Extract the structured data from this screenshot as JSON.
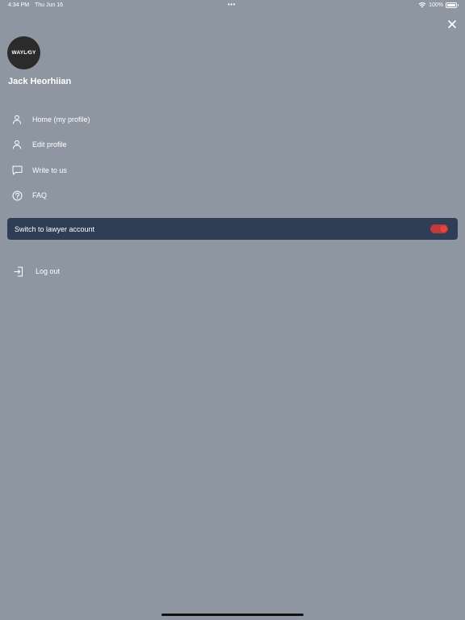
{
  "status_bar": {
    "time": "4:34 PM",
    "date": "Thu Jun 16",
    "dots": "•••",
    "battery": "100%",
    "icons": [
      "wifi-icon",
      "battery-icon"
    ]
  },
  "close": {
    "icon": "close-icon"
  },
  "profile": {
    "avatar_text": "WAYL⁄GY",
    "name": "Jack Heorhiian"
  },
  "menu": {
    "items": [
      {
        "label": "Home (my profile)",
        "icon": "person-icon"
      },
      {
        "label": "Edit profile",
        "icon": "person-icon"
      },
      {
        "label": "Write to us",
        "icon": "chat-icon"
      },
      {
        "label": "FAQ",
        "icon": "help-circle-icon"
      }
    ]
  },
  "switch": {
    "label": "Switch to lawyer account",
    "on": true,
    "color": "#e34444"
  },
  "logout": {
    "label": "Log out",
    "icon": "logout-icon"
  },
  "colors": {
    "background": "#8e96a2",
    "card": "#2f3d55",
    "accent": "#e34444"
  }
}
